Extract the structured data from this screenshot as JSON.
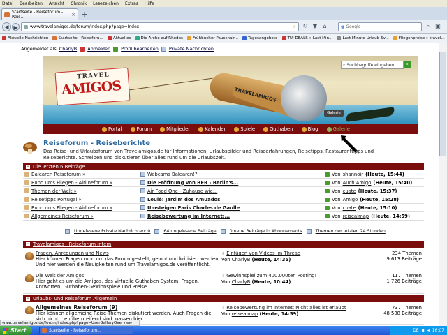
{
  "menubar": {
    "items": [
      "Datei",
      "Bearbeiten",
      "Ansicht",
      "Chronik",
      "Lesezeichen",
      "Extras",
      "Hilfe"
    ]
  },
  "tab": {
    "title": "Startseite - Reiseforum - Reis...",
    "new_tab_icon": "plus-icon"
  },
  "url": "www.travelamigos.de/forum/index.php?page=Index",
  "search_placeholder": "Google",
  "bookmarks": [
    "Aktuelle Nachrichten",
    "Startseite - Reiseforu...",
    "Aktuelles",
    "Die Arche auf Rhodos",
    "Frühbucher Pauschalr...",
    "Tagesangebote",
    "TUI DEALS » Last Min...",
    "Last Minute Urlaub 5v...",
    "Fliegenpreise » travel..."
  ],
  "user": {
    "prefix": "Angemeldet als",
    "name": "CharlyB",
    "logout": "Abmelden",
    "profile": "Profil bearbeiten",
    "messages": "Private Nachrichten"
  },
  "banner": {
    "logo_top": "TRAVEL",
    "logo_main": "AMIGOS",
    "plane_label": "TRAVELAMIGOS",
    "search_placeholder": "Suchbegriffe eingeben",
    "galerie": "Galerie"
  },
  "forumnav": [
    "Portal",
    "Forum",
    "Mitglieder",
    "Kalender",
    "Spiele",
    "Guthaben",
    "Blog",
    "Galerie"
  ],
  "forum": {
    "title": "Reiseforum - Reiseberichte",
    "description": "Das Reise- und Urlaubsforum von Travelamigos.de für Informationen, Urlaubsbilder und Reiseerfahrungen, Reisetipps, Restauranttipps und Reiseberichte. Schreiben und diskutieren über alles rund um die Urlaubszeit."
  },
  "latest": {
    "heading": "Die letzten 6 Beiträge",
    "rows": [
      {
        "forum": "Balearen Reiseforum »",
        "thread": "Webcams Balearen!?",
        "bold": false,
        "by": "Von",
        "user": "shannoir",
        "time": "(Heute, 15:44)"
      },
      {
        "forum": "Rund ums Fliegen - Airlineforum »",
        "thread": "Die Eröffnung von BER - Berlin's...",
        "bold": true,
        "by": "Von",
        "user": "Auch Amigo",
        "time": "(Heute, 15:40)"
      },
      {
        "forum": "Themen der Welt »",
        "thread": "Air Food One - Zuhause wie...",
        "bold": false,
        "by": "Von",
        "user": "cuate",
        "time": "(Heute, 15:37)"
      },
      {
        "forum": "Reisetipps Portugal »",
        "thread": "Loulé: Jardim dos Amuados",
        "bold": true,
        "by": "Von",
        "user": "Amigo",
        "time": "(Heute, 15:28)"
      },
      {
        "forum": "Rund ums Fliegen - Airlineforum »",
        "thread": "Umsteigen Paris Charles de Gaulle",
        "bold": true,
        "by": "Von",
        "user": "cuate",
        "time": "(Heute, 15:10)"
      },
      {
        "forum": "Allgemeines Reiseforum »",
        "thread": "Reisebewertung im Internet:...",
        "bold": true,
        "by": "Von",
        "user": "reisealmap",
        "time": "(Heute, 14:59)"
      }
    ]
  },
  "stats": {
    "unread_messages": "Ungelesene Private Nachrichten: 0",
    "unread_posts": "64 ungelesene Beiträge",
    "new_subscribed": "0 neue Beiträge in Abonnements",
    "last24": "Themen der letzten 24 Stunden"
  },
  "section2": {
    "heading": "Travelamigos - Reiseforum intern",
    "forums": [
      {
        "name": "Fragen, Anregungen und News",
        "desc": "Hier können Fragen rund um das Forum gestellt, gelobt und kritisiert werden. Und hier werden die Neuigkeiten rund um Travelamigos.de veröffentlicht.",
        "last_title": "Einfügen von Videos im Thread",
        "last_by": "Von",
        "last_user": "CharlyB",
        "last_time": "(Heute, 14:35)",
        "topics": "234 Themen",
        "posts": "9 613 Beiträge"
      },
      {
        "name": "Die Welt der Amigos",
        "desc": "Hier geht es um die Amigos, das virtuelle Guthaben-System. Fragen, Antworten, Guthaben-Gewinnspiele und Preise.",
        "last_title": "Gewinnspiel zum 400.000ten Posting!",
        "last_by": "Von",
        "last_user": "CharlyB",
        "last_time": "(Heute, 10:44)",
        "topics": "117 Themen",
        "posts": "1 726 Beiträge"
      }
    ]
  },
  "section3": {
    "heading": "Urlaubs- und Reiseforum Allgemein",
    "forums": [
      {
        "name": "Allgemeines Reiseforum (9)",
        "desc": "Hier können allgemeine Reise-Themen diskutiert werden. Auch Fragen die sich nicht ...enübergreifend sind, passen hier.",
        "last_title": "Reisebewertung im Internet: Nicht alles ist erlaubt",
        "last_by": "Von",
        "last_user": "reisealmap",
        "last_time": "(Heute, 14:59)",
        "topics": "737 Themen",
        "posts": "48 588 Beiträge"
      }
    ]
  },
  "statusbar": "www.travelamigos.de/forum/index.php?page=UserGalleryOverview",
  "taskbar": {
    "start": "Start",
    "item": "Startseite - Reiseforum...",
    "lang": "DE",
    "clock": "16:07"
  }
}
